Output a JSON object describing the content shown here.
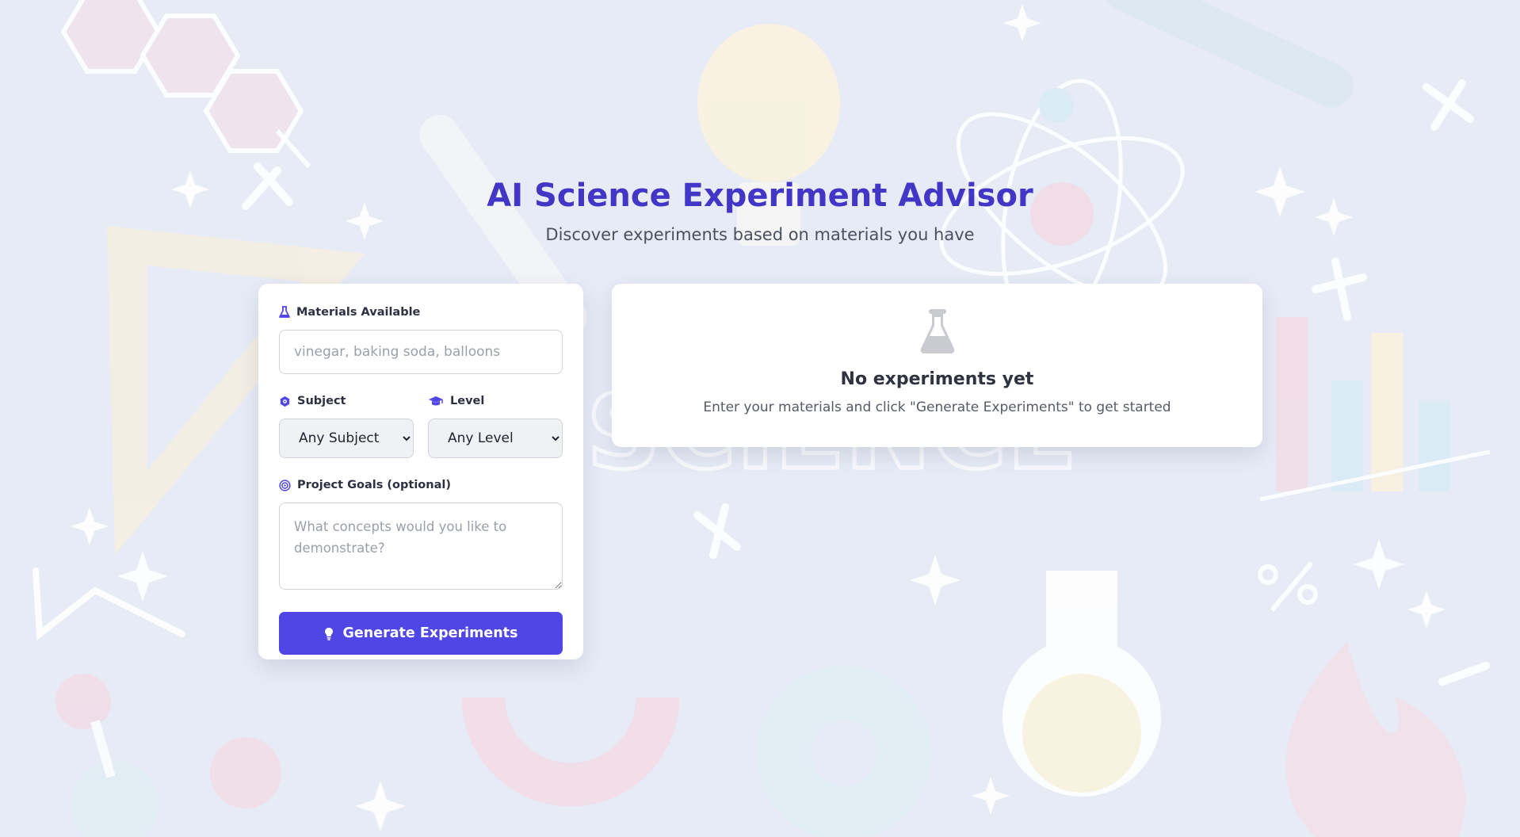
{
  "header": {
    "title": "AI Science Experiment Advisor",
    "subtitle": "Discover experiments based on materials you have"
  },
  "form": {
    "materials": {
      "label": "Materials Available",
      "icon": "flask-icon",
      "value": "",
      "placeholder": "vinegar, baking soda, balloons"
    },
    "subject": {
      "label": "Subject",
      "icon": "atom-icon",
      "selected": "Any Subject"
    },
    "level": {
      "label": "Level",
      "icon": "graduation-cap-icon",
      "selected": "Any Level"
    },
    "goals": {
      "label": "Project Goals (optional)",
      "icon": "target-icon",
      "value": "",
      "placeholder": "What concepts would you like to demonstrate?"
    },
    "generate_button": {
      "label": "Generate Experiments",
      "icon": "lightbulb-icon"
    }
  },
  "results": {
    "empty_icon": "flask-icon",
    "empty_title": "No experiments yet",
    "empty_text": "Enter your materials and click \"Generate Experiments\" to get started"
  },
  "colors": {
    "accent": "#4f46e5",
    "title": "#4236c6",
    "background": "#e6ebf6",
    "card": "#ffffff"
  }
}
